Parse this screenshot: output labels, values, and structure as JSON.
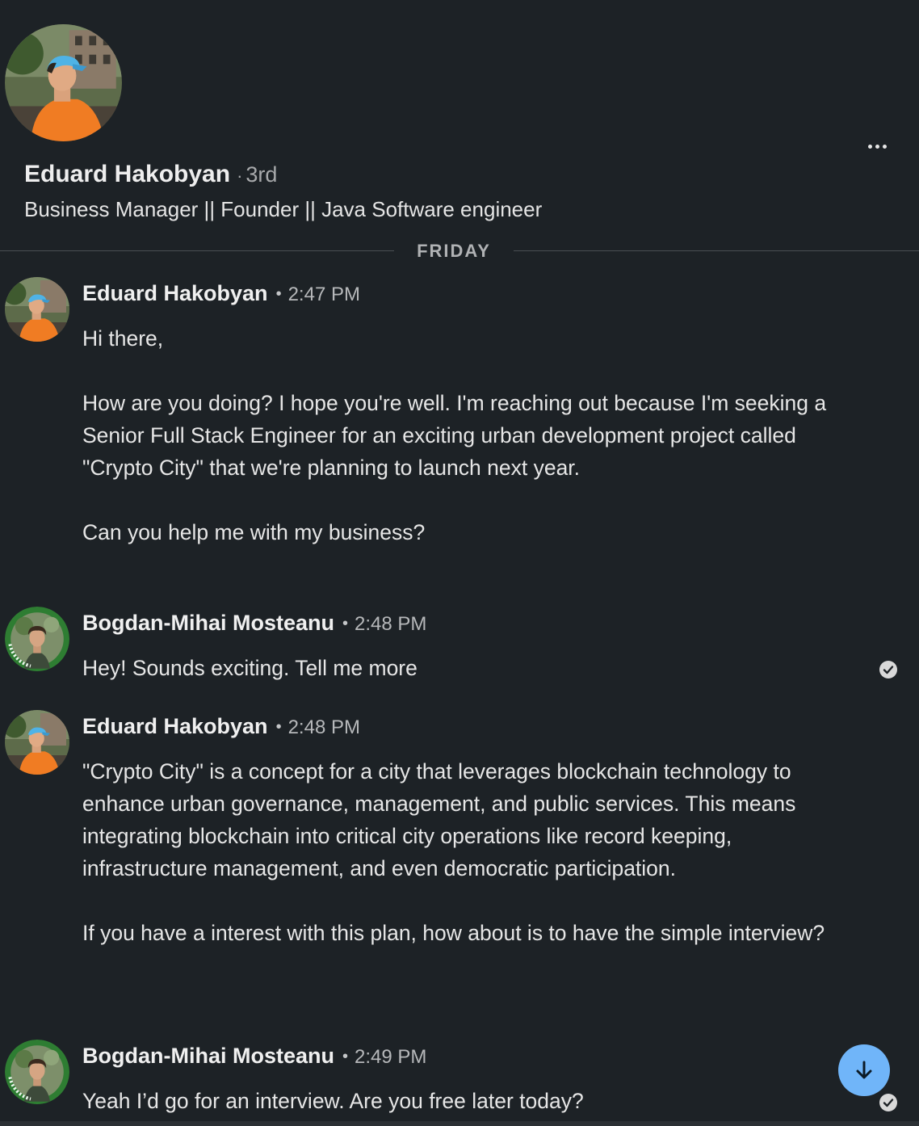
{
  "profile": {
    "name": "Eduard Hakobyan",
    "degree_separator": "·",
    "degree": "3rd",
    "headline": "Business Manager || Founder || Java Software engineer",
    "avatar_icon": "profile-photo-orange-shirt-blue-cap",
    "more_icon": "more-options-icon"
  },
  "date_divider": {
    "label": "FRIDAY"
  },
  "messages": [
    {
      "sender": "Eduard Hakobyan",
      "separator": "•",
      "time": "2:47 PM",
      "paragraphs": [
        "Hi there,",
        "How are you doing? I hope you're well. I'm reaching out because I'm seeking a Senior Full Stack Engineer for an exciting urban development project called \"Crypto City\" that we're planning to launch next year.",
        "Can you help me with my business?"
      ]
    },
    {
      "sender": "Bogdan-Mihai Mosteanu",
      "separator": "•",
      "time": "2:48 PM",
      "paragraphs": [
        "Hey! Sounds exciting. Tell me more"
      ],
      "avatar_badge": "#OPENTOWORK"
    },
    {
      "sender": "Eduard Hakobyan",
      "separator": "•",
      "time": "2:48 PM",
      "paragraphs": [
        "\"Crypto City\" is a concept for a city that leverages blockchain technology to enhance urban governance, management, and public services. This means integrating blockchain into critical city operations like record keeping, infrastructure management, and even democratic participation.",
        "If you have a interest with this plan, how about is to have the simple interview?"
      ]
    },
    {
      "sender": "Bogdan-Mihai Mosteanu",
      "separator": "•",
      "time": "2:49 PM",
      "paragraphs": [
        "Yeah I’d go for an interview. Are you free later today?"
      ],
      "avatar_badge": "#OPENTOWORK"
    }
  ],
  "icons": {
    "read_receipt": "read-receipt-check-icon",
    "scroll_down": "arrow-down-icon"
  },
  "colors": {
    "background": "#1d2226",
    "accent_button": "#70b5f9",
    "divider": "#4a4f53",
    "open_to_work_ring": "#2e7d32"
  }
}
